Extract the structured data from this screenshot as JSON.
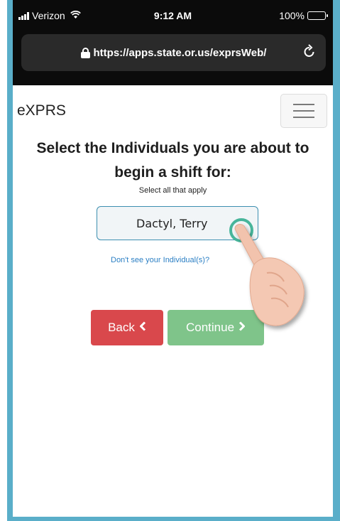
{
  "status_bar": {
    "carrier": "Verizon",
    "time": "9:12 AM",
    "battery": "100%"
  },
  "browser": {
    "url": "https://apps.state.or.us/exprsWeb/",
    "icons": [
      "lock-icon",
      "reload-icon",
      "wifi-icon",
      "signal-icon",
      "battery-icon"
    ]
  },
  "app": {
    "brand": "eXPRS",
    "heading": "Select the Individuals you are about to begin a shift for:",
    "subtext": "Select all that apply",
    "individual": "Dactyl, Terry",
    "missing_link": "Don't see your Individual(s)?",
    "back_label": "Back",
    "continue_label": "Continue"
  },
  "colors": {
    "frame": "#5aaec9",
    "back": "#d9484c",
    "continue": "#7fc48a",
    "link": "#2b7fc4",
    "selection_border": "#3d8fb0"
  }
}
